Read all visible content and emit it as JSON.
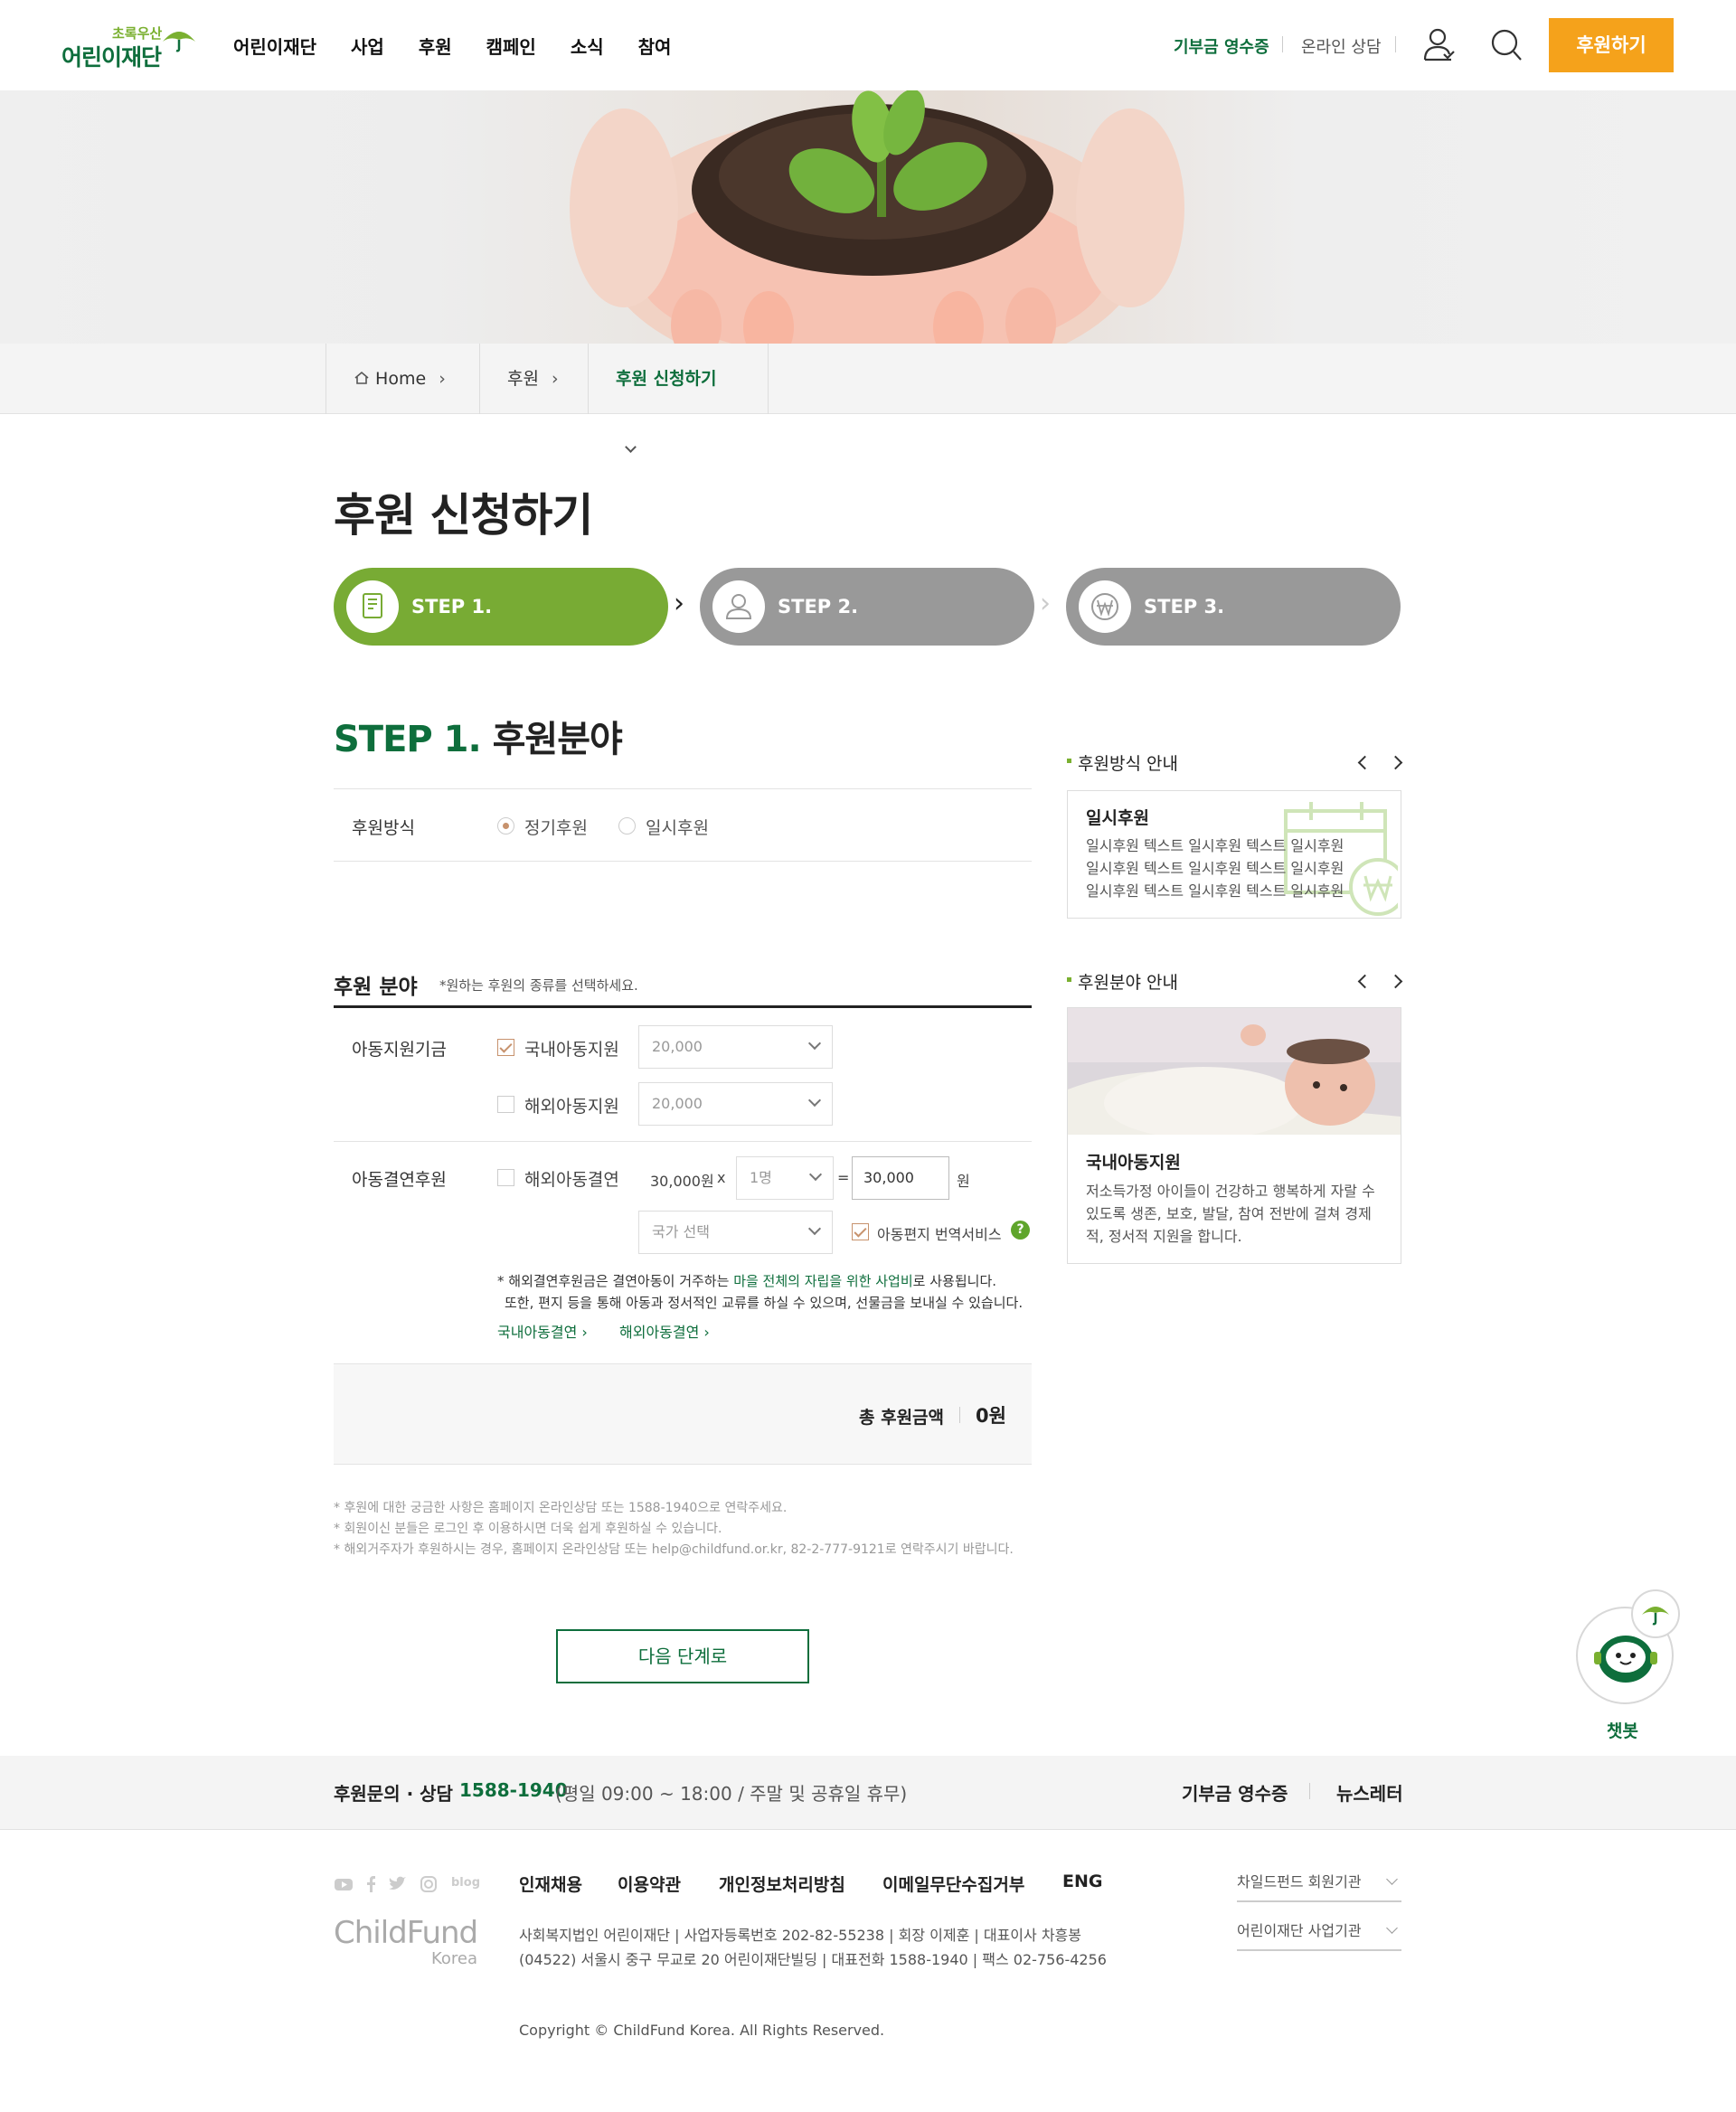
{
  "header": {
    "logo_small": "초록우산",
    "logo_main": "어린이재단",
    "nav": [
      "어린이재단",
      "사업",
      "후원",
      "캠페인",
      "소식",
      "참여"
    ],
    "receipt": "기부금 영수증",
    "consult": "온라인 상담",
    "donate_button": "후원하기"
  },
  "breadcrumb": {
    "home": "Home",
    "level1": "후원",
    "level2": "후원 신청하기"
  },
  "page_title": "후원 신청하기",
  "steps": [
    "STEP 1.",
    "STEP 2.",
    "STEP 3."
  ],
  "step_section": {
    "prefix": "STEP 1.",
    "title": "후원분야"
  },
  "method": {
    "label": "후원방식",
    "options": [
      "정기후원",
      "일시후원"
    ]
  },
  "field": {
    "title": "후원 분야",
    "hint": "*원하는 후원의 종류를 선택하세요.",
    "fund_label": "아동지원기금",
    "domestic": "국내아동지원",
    "domestic_amount": "20,000",
    "overseas": "해외아동지원",
    "overseas_amount": "20,000",
    "sponsor_label": "아동결연후원",
    "overseas_sponsor": "해외아동결연",
    "unit_price": "30,000원",
    "times": "x",
    "count": "1명",
    "equals": "=",
    "total_value": "30,000",
    "won": "원",
    "country_placeholder": "국가 선택",
    "translation": "아동편지 번역서비스",
    "help_mark": "?",
    "note1_a": "* 해외결연후원금은 결연아동이 거주하는 ",
    "note1_b": "마을 전체의 자립을 위한 사업비",
    "note1_c": "로 사용됩니다.",
    "note2": "또한, 편지 등을 통해 아동과 정서적인 교류를 하실 수 있으며, 선물금을 보내실 수 있습니다.",
    "link_domestic": "국내아동결연",
    "link_overseas": "해외아동결연"
  },
  "total": {
    "label": "총 후원금액",
    "amount": "0원"
  },
  "fine_print": [
    "* 후원에 대한 궁금한 사항은 홈페이지 온라인상담 또는 1588-1940으로 연락주세요.",
    "* 회원이신 분들은 로그인 후 이용하시면 더욱 쉽게 후원하실 수 있습니다.",
    "* 해외거주자가 후원하시는 경우, 홈페이지 온라인상담 또는 help@childfund.or.kr, 82-2-777-9121로 연락주시기 바랍니다."
  ],
  "next_button": "다음 단계로",
  "side": {
    "method_guide_title": "후원방식 안내",
    "method_card_title": "일시후원",
    "method_card_lines": [
      "일시후원 텍스트 일시후원 텍스트 일시후원",
      "일시후원 텍스트 일시후원 텍스트 일시후원",
      "일시후원 텍스트 일시후원 텍스트 일시후원"
    ],
    "field_guide_title": "후원분야 안내",
    "field_card_title": "국내아동지원",
    "field_card_lines": [
      "저소득가정 아이들이 건강하고 행복하게 자랄 수",
      "있도록 생존, 보호, 발달, 참여 전반에 걸쳐 경제",
      "적, 정서적 지원을 합니다."
    ]
  },
  "chatbot_label": "챗봇",
  "footer": {
    "contact_label": "후원문의 · 상담",
    "contact_phone": "1588-1940",
    "contact_hours": "(평일 09:00 ~ 18:00 / 주말 및 공휴일 휴무)",
    "receipt": "기부금 영수증",
    "newsletter": "뉴스레터",
    "social_blog": "blog",
    "menu": [
      "인재채용",
      "이용약관",
      "개인정보처리방침",
      "이메일무단수집거부",
      "ENG"
    ],
    "brand": "ChildFund",
    "brand_sub": "Korea",
    "info1": "사회복지법인 어린이재단 | 사업자등록번호 202-82-55238 | 회장 이제훈 | 대표이사 차흥봉",
    "info2": "(04522) 서울시 중구 무교로 20 어린이재단빌딩 | 대표전화 1588-1940 | 팩스 02-756-4256",
    "copyright": "Copyright © ChildFund Korea. All Rights Reserved.",
    "select1": "차일드펀드 회원기관",
    "select2": "어린이재단 사업기관"
  },
  "colors": {
    "brand_green": "#0e6e3c",
    "step_green": "#78ab34",
    "step_gray": "#999999",
    "donate_orange": "#f5a21b"
  }
}
